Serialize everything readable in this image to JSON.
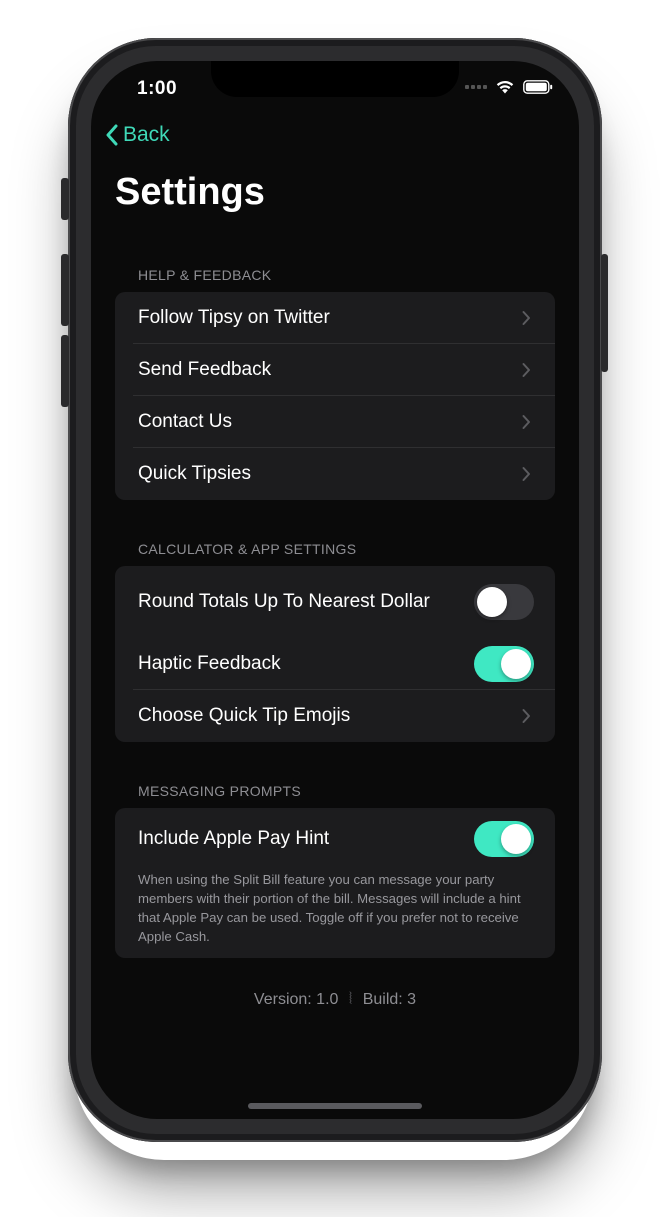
{
  "status_bar": {
    "time": "1:00",
    "icons": [
      "cellular-icon",
      "wifi-icon",
      "battery-icon"
    ]
  },
  "nav": {
    "back_label": "Back",
    "title": "Settings"
  },
  "sections": [
    {
      "header": "HELP & FEEDBACK",
      "rows": [
        {
          "label": "Follow Tipsy on Twitter",
          "accessory": "chevron"
        },
        {
          "label": "Send Feedback",
          "accessory": "chevron"
        },
        {
          "label": "Contact Us",
          "accessory": "chevron"
        },
        {
          "label": "Quick Tipsies",
          "accessory": "chevron"
        }
      ]
    },
    {
      "header": "CALCULATOR & APP SETTINGS",
      "rows": [
        {
          "label": "Round Totals Up To Nearest Dollar",
          "accessory": "toggle",
          "on": false
        },
        {
          "label": "Haptic Feedback",
          "accessory": "toggle",
          "on": true
        },
        {
          "label": "Choose Quick Tip Emojis",
          "accessory": "chevron"
        }
      ]
    },
    {
      "header": "MESSAGING PROMPTS",
      "rows": [
        {
          "label": "Include Apple Pay Hint",
          "accessory": "toggle",
          "on": true
        }
      ],
      "hint": "When using the Split Bill feature you can message your party members with their portion of the bill. Messages will include a hint that Apple Pay can be used. Toggle off if you prefer not to receive Apple Cash."
    }
  ],
  "footer": {
    "version": "Version: 1.0",
    "separator": "⦚",
    "build": "Build: 3"
  },
  "colors": {
    "accent": "#3fd9b8",
    "toggle_on": "#3fe8c3",
    "background": "#0a0a0a",
    "cell": "#1c1c1e"
  }
}
